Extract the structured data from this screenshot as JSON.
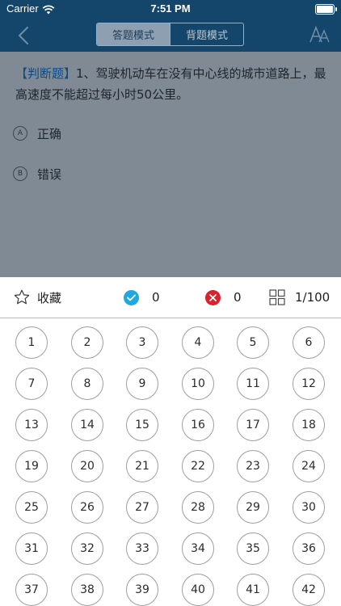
{
  "status_bar": {
    "carrier": "Carrier",
    "time": "7:51 PM"
  },
  "nav": {
    "mode_tabs": [
      {
        "label": "答题模式",
        "active": true
      },
      {
        "label": "背题模式",
        "active": false
      }
    ]
  },
  "question": {
    "type_tag": "【判断题】",
    "text": "1、驾驶机动车在没有中心线的城市道路上，最高速度不能超过每小时50公里。",
    "options": [
      {
        "letter": "A",
        "label": "正确"
      },
      {
        "letter": "B",
        "label": "错误"
      }
    ]
  },
  "stats": {
    "favorite_label": "收藏",
    "correct_count": "0",
    "wrong_count": "0",
    "progress": "1/100"
  },
  "grid": {
    "numbers": [
      "1",
      "2",
      "3",
      "4",
      "5",
      "6",
      "7",
      "8",
      "9",
      "10",
      "11",
      "12",
      "13",
      "14",
      "15",
      "16",
      "17",
      "18",
      "19",
      "20",
      "21",
      "22",
      "23",
      "24",
      "25",
      "26",
      "27",
      "28",
      "29",
      "30",
      "31",
      "32",
      "33",
      "34",
      "35",
      "36",
      "37",
      "38",
      "39",
      "40",
      "41",
      "42"
    ]
  },
  "colors": {
    "nav_bg": "#14456a",
    "correct": "#1fa8e0",
    "wrong": "#d8232a",
    "tag": "#114a80"
  }
}
